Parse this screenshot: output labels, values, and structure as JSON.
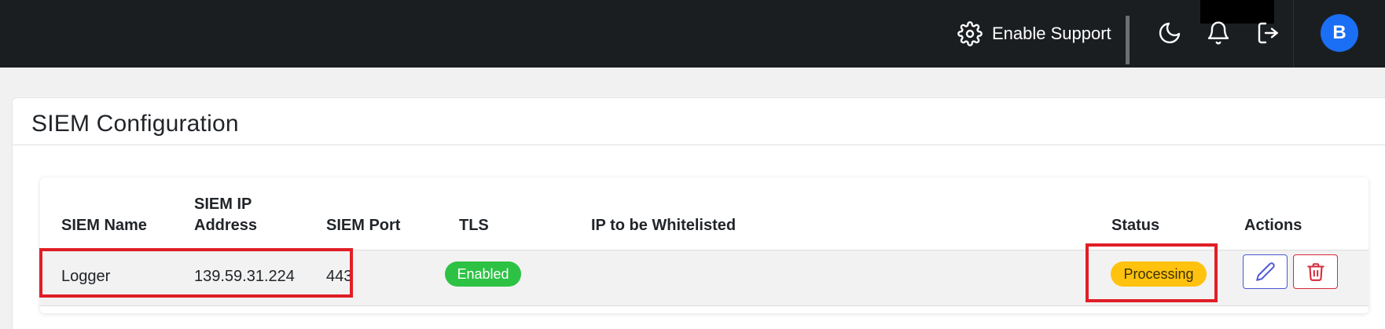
{
  "topbar": {
    "support_label": "Enable Support",
    "avatar_initial": "B",
    "icons": [
      "gear-icon",
      "moon-icon",
      "bell-icon",
      "logout-icon"
    ],
    "background": "#1b1e21",
    "avatar_color": "#1a6ff5"
  },
  "page": {
    "title": "SIEM Configuration"
  },
  "table": {
    "headers": {
      "name": "SIEM Name",
      "ip_line1": "SIEM IP",
      "ip_line2": "Address",
      "port": "SIEM Port",
      "tls": "TLS",
      "whitelist": "IP to be Whitelisted",
      "status": "Status",
      "actions": "Actions"
    },
    "rows": [
      {
        "name": "Logger",
        "ip": "139.59.31.224",
        "port": "443",
        "tls": "Enabled",
        "whitelist": "",
        "status": "Processing"
      }
    ]
  },
  "colors": {
    "tls_enabled": "#2dc244",
    "status_processing": "#ffc20e",
    "edit_accent": "#4c58d4",
    "delete_accent": "#d62a3a",
    "highlight": "#e01e26"
  }
}
